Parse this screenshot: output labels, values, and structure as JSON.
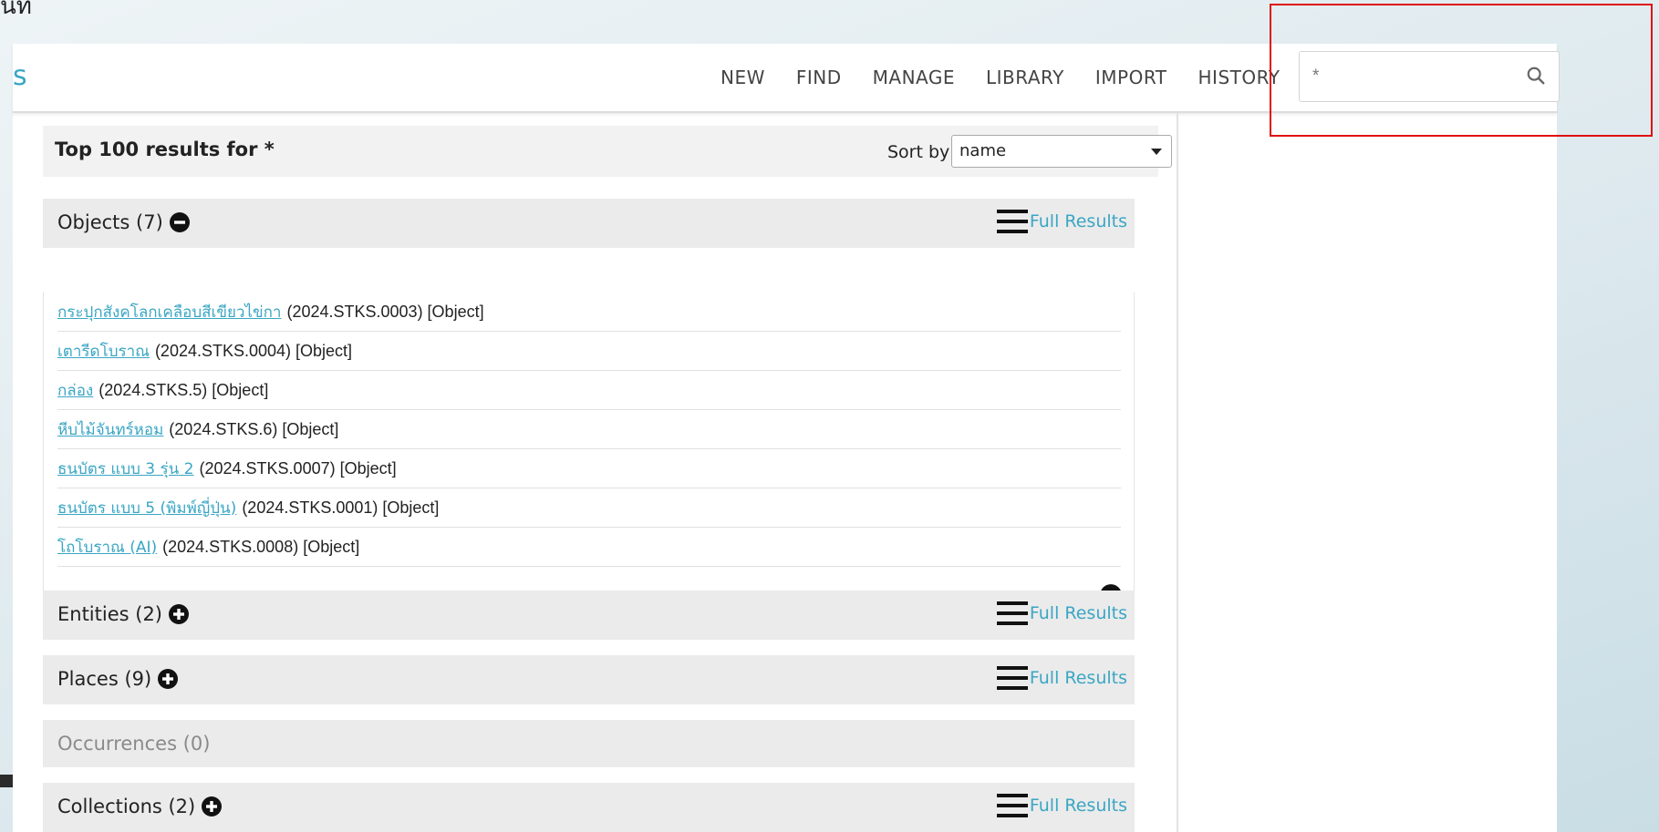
{
  "page_fragment": "ี่นที่",
  "logo_fragment": "s",
  "nav": {
    "items": [
      "NEW",
      "FIND",
      "MANAGE",
      "LIBRARY",
      "IMPORT",
      "HISTORY"
    ]
  },
  "search": {
    "value": "*"
  },
  "results": {
    "title": "Top 100 results for *",
    "sort_label": "Sort by",
    "sort_value": "name"
  },
  "full_results_label": "Full Results",
  "sections": {
    "objects": {
      "label": "Objects (7)"
    },
    "entities": {
      "label": "Entities (2)"
    },
    "places": {
      "label": "Places (9)"
    },
    "occurrences": {
      "label": "Occurrences (0)"
    },
    "collections": {
      "label": "Collections (2)"
    }
  },
  "objects": [
    {
      "name": "กระปุกสังคโลกเคลือบสีเขียวไข่กา",
      "meta": "(2024.STKS.0003) [Object]"
    },
    {
      "name": "เตารีดโบราณ",
      "meta": "(2024.STKS.0004) [Object]"
    },
    {
      "name": "กล่อง",
      "meta": "(2024.STKS.5) [Object]"
    },
    {
      "name": "หีบไม้จันทร์หอม",
      "meta": "(2024.STKS.6) [Object]"
    },
    {
      "name": "ธนบัตร แบบ 3 รุ่น 2",
      "meta": "(2024.STKS.0007) [Object]"
    },
    {
      "name": "ธนบัตร แบบ 5 (พิมพ์ญี่ปุ่น)",
      "meta": "(2024.STKS.0001) [Object]"
    },
    {
      "name": "โถโบราณ (AI)",
      "meta": "(2024.STKS.0008) [Object]"
    }
  ],
  "colors": {
    "accent": "#3aa6c4",
    "highlight": "#e01010"
  }
}
